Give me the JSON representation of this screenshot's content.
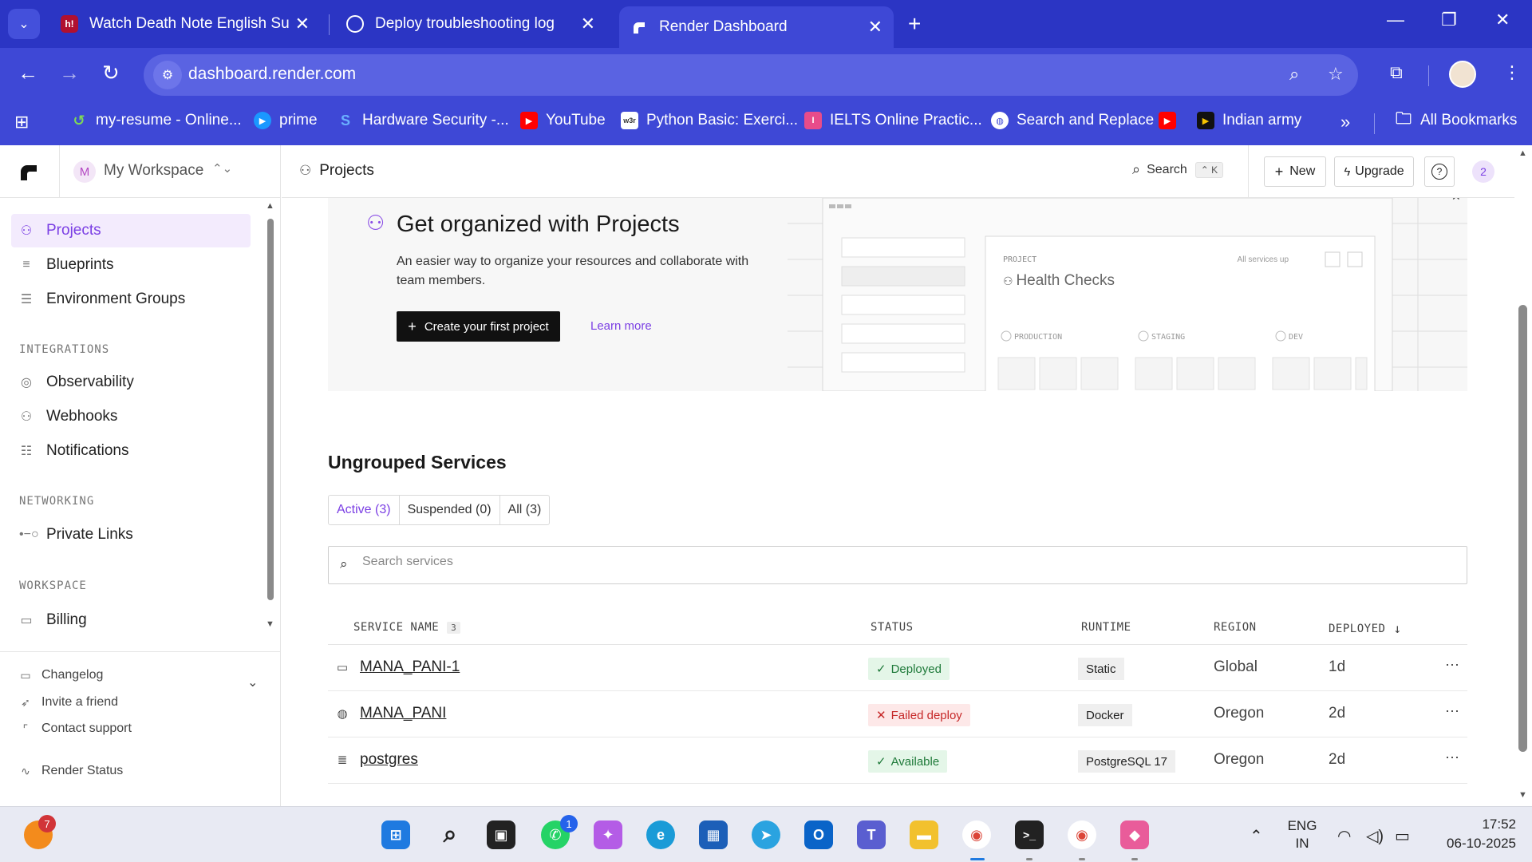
{
  "browser": {
    "tabs": [
      {
        "title": "Watch Death Note English Sub/",
        "favicon": "h-icon"
      },
      {
        "title": "Deploy troubleshooting log",
        "favicon": "openai-icon"
      },
      {
        "title": "Render Dashboard",
        "favicon": "render-icon",
        "active": true
      }
    ],
    "url": "dashboard.render.com",
    "bookmarks": [
      {
        "label": "my-resume - Online..."
      },
      {
        "label": "prime"
      },
      {
        "label": "Hardware Security -..."
      },
      {
        "label": "YouTube"
      },
      {
        "label": "Python Basic: Exerci..."
      },
      {
        "label": "IELTS Online Practic..."
      },
      {
        "label": "Search and Replace"
      },
      {
        "label": ""
      },
      {
        "label": "Indian army"
      }
    ],
    "all_bookmarks_label": "All Bookmarks"
  },
  "sidebar": {
    "workspace_initial": "M",
    "workspace_name": "My Workspace",
    "items": [
      {
        "label": "Projects",
        "icon": "projects-icon",
        "active": true
      },
      {
        "label": "Blueprints",
        "icon": "blueprints-icon"
      },
      {
        "label": "Environment Groups",
        "icon": "env-groups-icon"
      }
    ],
    "integrations_label": "INTEGRATIONS",
    "integrations": [
      {
        "label": "Observability",
        "icon": "observability-icon"
      },
      {
        "label": "Webhooks",
        "icon": "webhooks-icon"
      },
      {
        "label": "Notifications",
        "icon": "notifications-icon"
      }
    ],
    "networking_label": "NETWORKING",
    "networking": [
      {
        "label": "Private Links",
        "icon": "private-links-icon"
      }
    ],
    "workspace_label": "WORKSPACE",
    "workspace": [
      {
        "label": "Billing",
        "icon": "billing-icon"
      }
    ],
    "footer": {
      "changelog": "Changelog",
      "invite": "Invite a friend",
      "support": "Contact support",
      "status": "Render Status"
    }
  },
  "topbar": {
    "breadcrumb": "Projects",
    "search_label": "Search",
    "search_shortcut": "⌃ K",
    "new_label": "New",
    "upgrade_label": "Upgrade",
    "count_badge": "2"
  },
  "promo": {
    "title": "Get organized with Projects",
    "description": "An easier way to organize your resources and collaborate with team members.",
    "cta_label": "Create your first project",
    "learn_more": "Learn more",
    "art": {
      "project_label": "PROJECT",
      "project_name": "Health Checks",
      "status_text": "All services up",
      "envs": [
        "PRODUCTION",
        "STAGING",
        "DEV"
      ]
    }
  },
  "services": {
    "title": "Ungrouped Services",
    "filters": [
      {
        "label": "Active (3)",
        "active": true
      },
      {
        "label": "Suspended (0)"
      },
      {
        "label": "All (3)"
      }
    ],
    "search_placeholder": "Search services",
    "columns": {
      "name": "SERVICE NAME",
      "count": "3",
      "status": "STATUS",
      "runtime": "RUNTIME",
      "region": "REGION",
      "deployed": "DEPLOYED"
    },
    "rows": [
      {
        "name": "MANA_PANI-1",
        "icon": "static-site-icon",
        "status": "Deployed",
        "status_kind": "ok",
        "runtime": "Static",
        "region": "Global",
        "deployed": "1d"
      },
      {
        "name": "MANA_PANI",
        "icon": "globe-icon",
        "status": "Failed deploy",
        "status_kind": "fail",
        "runtime": "Docker",
        "region": "Oregon",
        "deployed": "2d"
      },
      {
        "name": "postgres",
        "icon": "database-icon",
        "status": "Available",
        "status_kind": "ok",
        "runtime": "PostgreSQL 17",
        "region": "Oregon",
        "deployed": "2d"
      }
    ]
  },
  "taskbar": {
    "notification_badge": "7",
    "whatsapp_badge": "1",
    "lang_top": "ENG",
    "lang_bottom": "IN",
    "time": "17:52",
    "date": "06-10-2025"
  },
  "colors": {
    "chrome": "#3e48d6",
    "accent": "#7b3fe4",
    "ok": "#1f7a3a",
    "fail": "#c62828"
  }
}
